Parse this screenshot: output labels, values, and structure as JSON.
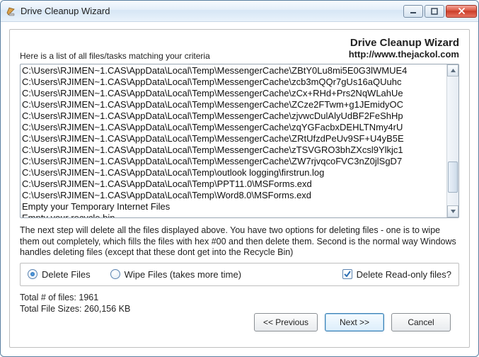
{
  "window": {
    "title": "Drive Cleanup Wizard"
  },
  "brand": {
    "title": "Drive Cleanup Wizard",
    "url": "http://www.thejackol.com"
  },
  "labels": {
    "criteria": "Here is a list of all files/tasks matching your criteria",
    "description": "The next step will delete all the files displayed above. You have two options for deleting files - one is to wipe them out completely, which fills the files with hex #00 and then delete them. Second is the normal way Windows handles deleting files (except that these dont get into the Recycle Bin)"
  },
  "files": [
    "C:\\Users\\RJIMEN~1.CAS\\AppData\\Local\\Temp\\MessengerCache\\ZBtY0Lu8mi5E0G3lWMUE4",
    "C:\\Users\\RJIMEN~1.CAS\\AppData\\Local\\Temp\\MessengerCache\\zcb3mQQr7gUs16aQUuhc",
    "C:\\Users\\RJIMEN~1.CAS\\AppData\\Local\\Temp\\MessengerCache\\zCx+RHd+Prs2NqWLahUe",
    "C:\\Users\\RJIMEN~1.CAS\\AppData\\Local\\Temp\\MessengerCache\\ZCze2FTwm+g1JEmidyOC",
    "C:\\Users\\RJIMEN~1.CAS\\AppData\\Local\\Temp\\MessengerCache\\zjvwcDulAlyUdBF2FeShHp",
    "C:\\Users\\RJIMEN~1.CAS\\AppData\\Local\\Temp\\MessengerCache\\zqYGFacbxDEHLTNmy4rU",
    "C:\\Users\\RJIMEN~1.CAS\\AppData\\Local\\Temp\\MessengerCache\\ZRtUfzdPeUv9SF+U4yB5E",
    "C:\\Users\\RJIMEN~1.CAS\\AppData\\Local\\Temp\\MessengerCache\\zTSVGRO3bhZXcsl9Ylkjc1",
    "C:\\Users\\RJIMEN~1.CAS\\AppData\\Local\\Temp\\MessengerCache\\ZW7rjvqcoFVC3nZ0jlSgD7",
    "C:\\Users\\RJIMEN~1.CAS\\AppData\\Local\\Temp\\outlook logging\\firstrun.log",
    "C:\\Users\\RJIMEN~1.CAS\\AppData\\Local\\Temp\\PPT11.0\\MSForms.exd",
    "C:\\Users\\RJIMEN~1.CAS\\AppData\\Local\\Temp\\Word8.0\\MSForms.exd",
    "Empty your Temporary Internet Files",
    "Empty your recycle bin"
  ],
  "options": {
    "delete_label": "Delete Files",
    "wipe_label": "Wipe Files (takes more time)",
    "readonly_label": "Delete Read-only files?",
    "selected": "delete",
    "readonly_checked": true
  },
  "totals": {
    "files_label": "Total # of files: 1961",
    "size_label": "Total File Sizes: 260,156 KB"
  },
  "buttons": {
    "previous": "<< Previous",
    "next": "Next >>",
    "cancel": "Cancel"
  }
}
